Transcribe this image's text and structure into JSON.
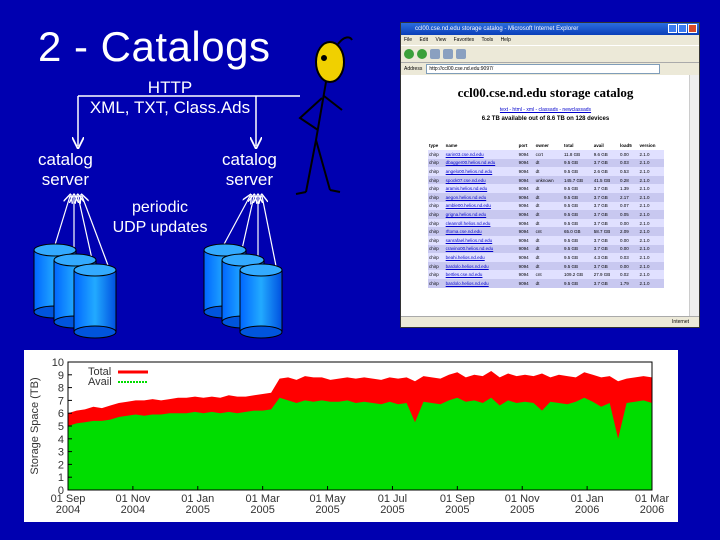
{
  "slide": {
    "title": "2 - Catalogs",
    "http_label": "HTTP",
    "formats_label": "XML, TXT, Class.Ads",
    "left_server": [
      "catalog",
      "server"
    ],
    "right_server": [
      "catalog",
      "server"
    ],
    "periodic": [
      "periodic",
      "UDP updates"
    ]
  },
  "browser": {
    "window_title": "ccl00.cse.nd.edu storage catalog - Microsoft Internet Explorer",
    "menu": [
      "File",
      "Edit",
      "View",
      "Favorites",
      "Tools",
      "Help"
    ],
    "address_label": "Address",
    "address_value": "http://ccl00.cse.nd.edu:9097/",
    "heading": "ccl00.cse.nd.edu storage catalog",
    "links": "text - html - xml - classads - newclassads",
    "available": "6.2 TB available out of 8.6 TB on 128 devices",
    "status": "Internet",
    "columns": [
      "type",
      "name",
      "port",
      "owner",
      "total",
      "avail",
      "load5",
      "version"
    ],
    "rows": [
      [
        "chirp",
        "sarin03.cse.nd.edu",
        "9094",
        "ccrt",
        "11.8 GB",
        "9.6 GB",
        "0.00",
        "2.1.0"
      ],
      [
        "chirp",
        "dbagger00.helios.nd.edu",
        "9094",
        "dt",
        "9.5 GB",
        "3.7 GB",
        "0.03",
        "2.1.0"
      ],
      [
        "chirp",
        "angelo00.helios.nd.edu",
        "9094",
        "dt",
        "9.5 GB",
        "2.6 GB",
        "0.53",
        "2.1.0"
      ],
      [
        "chirp",
        "spock07.cse.nd.edu",
        "9094",
        "unknown",
        "145.7 GB",
        "41.5 GB",
        "0.28",
        "2.1.0"
      ],
      [
        "chirp",
        "aramis.helios.nd.edu",
        "9094",
        "dt",
        "9.5 GB",
        "3.7 GB",
        "1.39",
        "2.1.0"
      ],
      [
        "chirp",
        "aegon.helios.nd.edu",
        "9094",
        "dt",
        "9.5 GB",
        "3.7 GB",
        "2.17",
        "2.1.0"
      ],
      [
        "chirp",
        "amble00.helios.nd.edu",
        "9094",
        "dt",
        "9.5 GB",
        "3.7 GB",
        "0.07",
        "2.1.0"
      ],
      [
        "chirp",
        "grigna.helios.nd.edu",
        "9094",
        "dt",
        "9.5 GB",
        "3.7 GB",
        "0.05",
        "2.1.0"
      ],
      [
        "chirp",
        "cleanroll.helios.nd.edu",
        "9094",
        "dt",
        "9.5 GB",
        "3.7 GB",
        "0.00",
        "2.1.0"
      ],
      [
        "chirp",
        "rftoma.cse.nd.edu",
        "9094",
        "cnt",
        "65.0 GB",
        "58.7 GB",
        "2.09",
        "2.1.0"
      ],
      [
        "chirp",
        "sanrafael.helios.nd.edu",
        "9094",
        "dt",
        "9.5 GB",
        "3.7 GB",
        "0.00",
        "2.1.0"
      ],
      [
        "chirp",
        "cravino00.helios.nd.edu",
        "9094",
        "dt",
        "9.5 GB",
        "3.7 GB",
        "0.00",
        "2.1.0"
      ],
      [
        "chirp",
        "beahi.helios.nd.edu",
        "9094",
        "dt",
        "9.5 GB",
        "4.3 GB",
        "0.03",
        "2.1.0"
      ],
      [
        "chirp",
        "bardolo.helios.nd.edu",
        "9094",
        "dt",
        "9.5 GB",
        "3.7 GB",
        "0.00",
        "2.1.0"
      ],
      [
        "chirp",
        "bertles.cse.nd.edu",
        "9094",
        "cnt",
        "109.2 GB",
        "27.9 GB",
        "0.02",
        "2.1.0"
      ],
      [
        "chirp",
        "bardolo.helios.nd.edu",
        "9094",
        "dt",
        "9.5 GB",
        "3.7 GB",
        "1.79",
        "2.1.0"
      ]
    ]
  },
  "chart_data": {
    "type": "area",
    "ylabel": "Storage Space (TB)",
    "ylim": [
      0,
      10
    ],
    "yticks": [
      0,
      1,
      2,
      3,
      4,
      5,
      6,
      7,
      8,
      9,
      10
    ],
    "xticks": [
      [
        "01 Sep",
        "2004"
      ],
      [
        "01 Nov",
        "2004"
      ],
      [
        "01 Jan",
        "2005"
      ],
      [
        "01 Mar",
        "2005"
      ],
      [
        "01 May",
        "2005"
      ],
      [
        "01 Jul",
        "2005"
      ],
      [
        "01 Sep",
        "2005"
      ],
      [
        "01 Nov",
        "2005"
      ],
      [
        "01 Jan",
        "2006"
      ],
      [
        "01 Mar",
        "2006"
      ]
    ],
    "series": [
      {
        "name": "Total",
        "color": "#ff0000",
        "values": [
          6.0,
          6.2,
          6.3,
          6.5,
          6.4,
          6.6,
          6.8,
          6.9,
          7.0,
          7.0,
          7.1,
          7.0,
          7.1,
          7.2,
          7.2,
          7.3,
          7.2,
          7.3,
          7.2,
          7.4,
          7.3,
          7.3,
          7.4,
          7.5,
          7.6,
          8.7,
          8.8,
          8.6,
          8.9,
          8.8,
          8.8,
          8.6,
          8.7,
          8.8,
          8.7,
          8.8,
          8.7,
          8.6,
          8.8,
          8.7,
          8.8,
          8.5,
          8.9,
          8.8,
          8.7,
          9.0,
          9.2,
          8.8,
          9.0,
          8.9,
          9.3,
          8.8,
          9.1,
          8.9,
          9.0,
          8.9,
          9.1,
          8.8,
          9.0,
          8.9,
          8.8,
          9.2,
          9.0,
          8.8,
          8.9,
          8.5,
          8.7,
          8.8,
          8.9,
          8.8
        ]
      },
      {
        "name": "Avail",
        "color": "#00dd00",
        "values": [
          5.0,
          5.2,
          5.3,
          5.4,
          5.4,
          5.5,
          5.7,
          5.8,
          5.9,
          5.8,
          5.9,
          5.9,
          6.0,
          6.0,
          6.0,
          6.1,
          6.0,
          6.1,
          6.0,
          6.1,
          6.0,
          6.1,
          6.2,
          6.2,
          6.3,
          7.2,
          7.0,
          6.8,
          7.0,
          6.9,
          7.0,
          6.9,
          6.9,
          7.0,
          6.8,
          6.9,
          6.8,
          6.7,
          6.9,
          6.7,
          6.8,
          5.3,
          6.9,
          6.8,
          6.7,
          7.0,
          7.2,
          6.9,
          7.0,
          6.8,
          7.2,
          6.6,
          7.0,
          6.8,
          6.9,
          6.8,
          6.2,
          6.9,
          6.8,
          6.7,
          6.9,
          7.2,
          6.9,
          6.5,
          6.8,
          4.0,
          6.8,
          6.9,
          7.0,
          6.8
        ]
      }
    ],
    "legend": "top-left",
    "grid": false
  }
}
